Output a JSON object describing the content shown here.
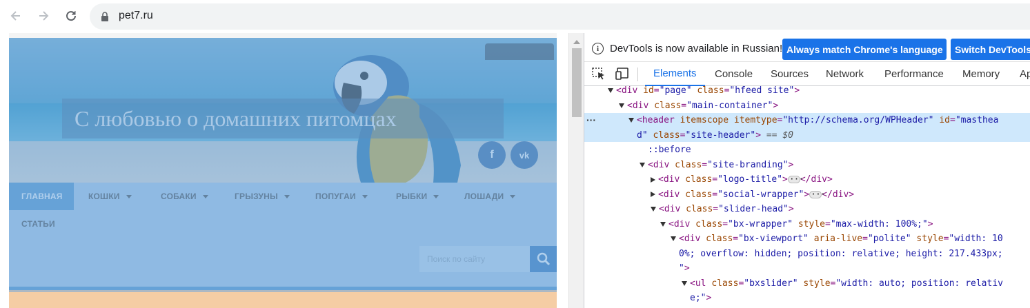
{
  "browser": {
    "url": "pet7.ru",
    "back_icon": "arrow-left-icon",
    "forward_icon": "arrow-right-icon",
    "reload_icon": "reload-icon",
    "lock_icon": "lock-icon"
  },
  "site": {
    "title": "С любовью о домашних питомцах",
    "social": [
      {
        "name": "facebook",
        "glyph": "f"
      },
      {
        "name": "vk",
        "glyph": "vk"
      }
    ],
    "menu": [
      {
        "label": "ГЛАВНАЯ",
        "active": true
      },
      {
        "label": "КОШКИ"
      },
      {
        "label": "СОБАКИ"
      },
      {
        "label": "ГРЫЗУНЫ"
      },
      {
        "label": "ПОПУГАИ"
      },
      {
        "label": "РЫБКИ"
      },
      {
        "label": "ЛОШАДИ"
      },
      {
        "label": "СТАТЬИ"
      }
    ],
    "search_placeholder": "Поиск по сайту"
  },
  "devtools": {
    "info_text": "DevTools is now available in Russian!",
    "btn_match": "Always match Chrome's language",
    "btn_switch": "Switch DevTools",
    "tabs": [
      "Elements",
      "Console",
      "Sources",
      "Network",
      "Performance",
      "Memory",
      "Ap"
    ],
    "active_tab": "Elements",
    "lines": {
      "l1": {
        "tag": "<div ",
        "a1": "id",
        "v1": "\"page\"",
        "a2": "class",
        "v2": "\"hfeed site\"",
        "end": ">"
      },
      "l2": {
        "tag": "<div ",
        "a1": "class",
        "v1": "\"main-container\"",
        "end": ">"
      },
      "l3a": {
        "tag": "<header ",
        "a1": "itemscope",
        "a2": "itemtype",
        "v2": "\"http://schema.org/WPHeader\"",
        "a3": "id",
        "v3": "\"masthea"
      },
      "l3b": {
        "v3": "d\"",
        "a4": "class",
        "v4": "\"site-header\"",
        "end": ">",
        "eq": " == $0"
      },
      "l4": {
        "text": "::before"
      },
      "l5": {
        "tag": "<div ",
        "a1": "class",
        "v1": "\"site-branding\"",
        "end": ">"
      },
      "l6": {
        "tag": "<div ",
        "a1": "class",
        "v1": "\"logo-title\"",
        "end": ">",
        "close": "</div>"
      },
      "l7": {
        "tag": "<div ",
        "a1": "class",
        "v1": "\"social-wrapper\"",
        "end": ">",
        "close": "</div>"
      },
      "l8": {
        "tag": "<div ",
        "a1": "class",
        "v1": "\"slider-head\"",
        "end": ">"
      },
      "l9": {
        "tag": "<div ",
        "a1": "class",
        "v1": "\"bx-wrapper\"",
        "a2": "style",
        "v2": "\"max-width: 100%;\"",
        "end": ">"
      },
      "l10a": {
        "tag": "<div ",
        "a1": "class",
        "v1": "\"bx-viewport\"",
        "a2": "aria-live",
        "v2": "\"polite\"",
        "a3": "style",
        "v3": "\"width: 10"
      },
      "l10b": {
        "v3": "0%; overflow: hidden; position: relative; height: 217.433px;"
      },
      "l10c": {
        "v3": "\"",
        "end": ">"
      },
      "l11a": {
        "tag": "<ul ",
        "a1": "class",
        "v1": "\"bxslider\"",
        "a2": "style",
        "v2": "\"width: auto; position: relativ"
      },
      "l11b": {
        "v2": "e;\"",
        "end": ">"
      }
    }
  }
}
